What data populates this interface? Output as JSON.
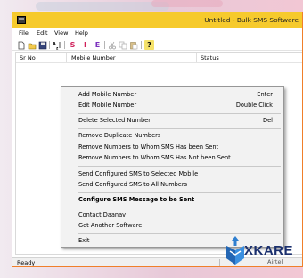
{
  "window": {
    "title": "Untitled - Bulk SMS Software",
    "colors": {
      "title_bg": "#f6ca2c",
      "border": "#f07f2a"
    }
  },
  "menubar": [
    "File",
    "Edit",
    "View",
    "Help"
  ],
  "toolbar": {
    "icons": [
      "new-icon",
      "open-icon",
      "save-icon",
      "sort-icon",
      "s-icon",
      "i-icon",
      "e-icon",
      "cut-icon",
      "copy-icon",
      "paste-icon",
      "help-icon"
    ],
    "labels": {
      "s": "S",
      "i": "I",
      "e": "E",
      "help": "?"
    }
  },
  "list": {
    "columns": [
      "Sr No",
      "Mobile Number",
      "Status"
    ]
  },
  "context_menu": {
    "items": [
      {
        "label": "Add Mobile Number",
        "shortcut": "Enter"
      },
      {
        "label": "Edit Mobile Number",
        "shortcut": "Double Click"
      },
      {
        "label": "Delete Selected Number",
        "shortcut": "Del"
      },
      {
        "label": "Remove Duplicate Numbers",
        "shortcut": ""
      },
      {
        "label": "Remove Numbers to Whom SMS Has been Sent",
        "shortcut": ""
      },
      {
        "label": "Remove Numbers to Whom SMS Has Not been Sent",
        "shortcut": ""
      },
      {
        "label": "Send Configured SMS to Selected Mobile",
        "shortcut": ""
      },
      {
        "label": "Send Configured SMS to All Numbers",
        "shortcut": ""
      },
      {
        "label": "Configure SMS Message to be Sent",
        "shortcut": ""
      },
      {
        "label": "Contact Daanav",
        "shortcut": ""
      },
      {
        "label": "Get Another Software",
        "shortcut": ""
      },
      {
        "label": "Exit",
        "shortcut": ""
      }
    ]
  },
  "statusbar": {
    "text": "Ready",
    "right": "Airtel"
  },
  "watermark": {
    "text": "XKARE"
  }
}
